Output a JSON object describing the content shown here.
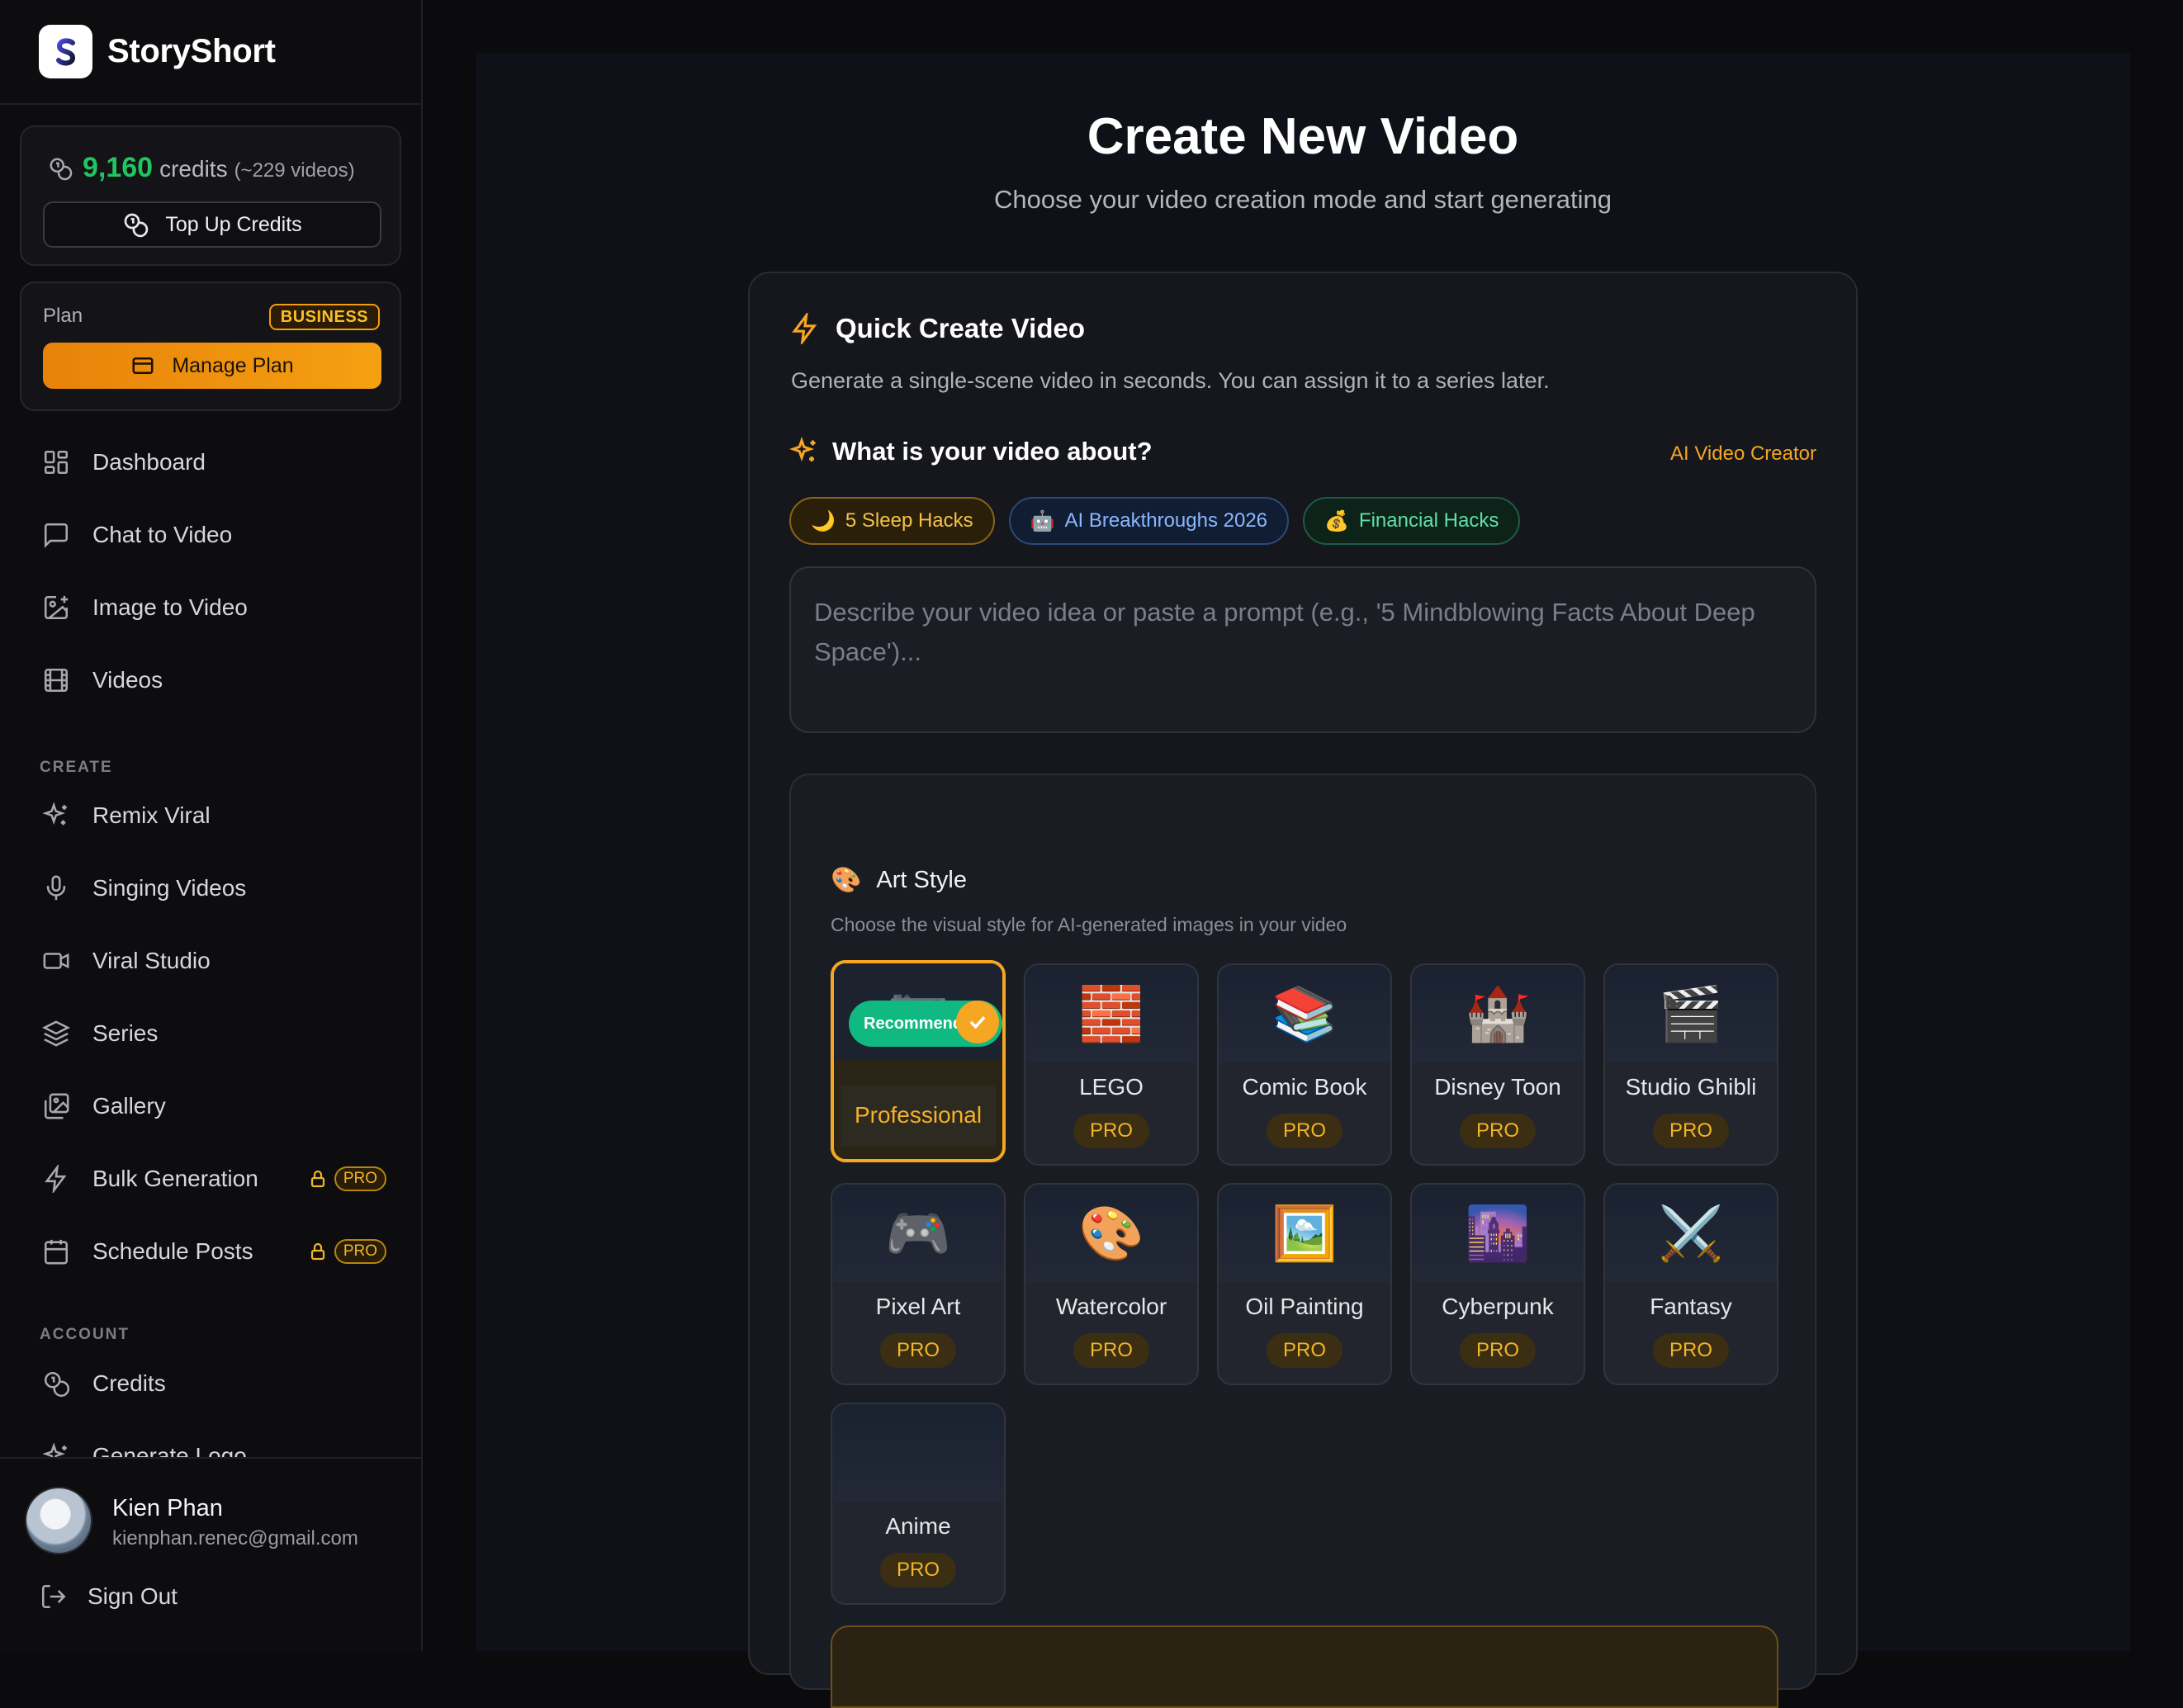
{
  "brand": {
    "name": "StoryShort"
  },
  "credits": {
    "amount": "9,160",
    "word": "credits",
    "videos": "(~229 videos)",
    "topup_label": "Top Up Credits"
  },
  "plan": {
    "label": "Plan",
    "badge": "BUSINESS",
    "manage_label": "Manage Plan",
    "badge_color": "#f59e0b"
  },
  "nav": {
    "main": [
      {
        "label": "Dashboard",
        "icon": "dashboard-icon"
      },
      {
        "label": "Chat to Video",
        "icon": "chat-icon"
      },
      {
        "label": "Image to Video",
        "icon": "image-plus-icon"
      },
      {
        "label": "Videos",
        "icon": "film-icon"
      }
    ],
    "create_heading": "CREATE",
    "create": [
      {
        "label": "Remix Viral",
        "icon": "sparkles-icon"
      },
      {
        "label": "Singing Videos",
        "icon": "mic-icon"
      },
      {
        "label": "Viral Studio",
        "icon": "video-camera-icon"
      },
      {
        "label": "Series",
        "icon": "layers-icon"
      },
      {
        "label": "Gallery",
        "icon": "gallery-icon"
      },
      {
        "label": "Bulk Generation",
        "icon": "bolt-icon",
        "pro": "PRO"
      },
      {
        "label": "Schedule Posts",
        "icon": "calendar-icon",
        "pro": "PRO"
      }
    ],
    "account_heading": "ACCOUNT",
    "account": [
      {
        "label": "Credits",
        "icon": "coins-icon"
      },
      {
        "label": "Generate Logo",
        "icon": "sparkles-icon"
      }
    ]
  },
  "user": {
    "name": "Kien Phan",
    "email": "kienphan.renec@gmail.com",
    "signout_label": "Sign Out"
  },
  "main": {
    "title": "Create New Video",
    "subtitle": "Choose your video creation mode and start generating",
    "quick_create": {
      "title": "Quick Create Video",
      "description": "Generate a single-scene video in seconds. You can assign it to a series later.",
      "about_title": "What is your video about?",
      "ai_link": "AI Video Creator",
      "chips": [
        {
          "emoji": "🌙",
          "label": "5 Sleep Hacks",
          "tone": "amber"
        },
        {
          "emoji": "🤖",
          "label": "AI Breakthroughs 2026",
          "tone": "blue"
        },
        {
          "emoji": "💰",
          "label": "Financial Hacks",
          "tone": "green"
        }
      ],
      "prompt_placeholder": "Describe your video idea or paste a prompt (e.g., '5 Mindblowing Facts About Deep Space')...",
      "prompt_value": ""
    },
    "art_style": {
      "emoji": "🎨",
      "title": "Art Style",
      "description": "Choose the visual style for AI-generated images in your video",
      "recommended_label": "Recommended",
      "pro_label": "PRO",
      "styles": [
        {
          "name": "Professional",
          "emoji": "📷",
          "selected": true,
          "pro": false
        },
        {
          "name": "LEGO",
          "emoji": "🧱",
          "selected": false,
          "pro": true
        },
        {
          "name": "Comic Book",
          "emoji": "📚",
          "selected": false,
          "pro": true
        },
        {
          "name": "Disney Toon",
          "emoji": "🏰",
          "selected": false,
          "pro": true
        },
        {
          "name": "Studio Ghibli",
          "emoji": "🎬",
          "selected": false,
          "pro": true
        },
        {
          "name": "Pixel Art",
          "emoji": "🎮",
          "selected": false,
          "pro": true
        },
        {
          "name": "Watercolor",
          "emoji": "🎨",
          "selected": false,
          "pro": true
        },
        {
          "name": "Oil Painting",
          "emoji": "🖼️",
          "selected": false,
          "pro": true
        },
        {
          "name": "Cyberpunk",
          "emoji": "🌆",
          "selected": false,
          "pro": true
        },
        {
          "name": "Fantasy",
          "emoji": "⚔️",
          "selected": false,
          "pro": true
        },
        {
          "name": "Anime",
          "emoji": "",
          "selected": false,
          "pro": true
        }
      ]
    }
  }
}
